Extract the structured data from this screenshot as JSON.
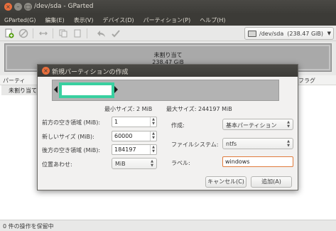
{
  "window": {
    "title": "/dev/sda - GParted",
    "close_glyph": "×",
    "min_glyph": "–",
    "max_glyph": "□"
  },
  "menubar": {
    "items": [
      "GParted(G)",
      "編集(E)",
      "表示(V)",
      "デバイス(D)",
      "パーティション(P)",
      "ヘルプ(H)"
    ]
  },
  "toolbar": {
    "icons": [
      "new-icon",
      "delete-icon",
      "resize-icon",
      "copy-icon",
      "paste-icon",
      "undo-icon",
      "apply-icon"
    ],
    "device_label": "/dev/sda",
    "device_size": "(238.47 GiB)"
  },
  "disk": {
    "label": "未割り当て",
    "size": "238.47 GiB"
  },
  "partition_list": {
    "headers": [
      "パーティ",
      "フラグ"
    ],
    "rows": [
      "未割り当て"
    ]
  },
  "statusbar": {
    "text": "0 件の操作を保留中"
  },
  "dialog": {
    "title": "新規パーティションの作成",
    "close_glyph": "×",
    "min_size": "最小サイズ: 2 MiB",
    "max_size": "最大サイズ: 244197 MiB",
    "fields": {
      "free_before": {
        "label": "前方の空き領域 (MiB):",
        "value": "1"
      },
      "new_size": {
        "label": "新しいサイズ (MiB):",
        "value": "60000"
      },
      "free_after": {
        "label": "後方の空き領域 (MiB):",
        "value": "184197"
      },
      "align": {
        "label": "位置あわせ:",
        "value": "MiB"
      },
      "create_as": {
        "label": "作成:",
        "value": "基本パーティション"
      },
      "filesystem": {
        "label": "ファイルシステム:",
        "value": "ntfs"
      },
      "label": {
        "label": "ラベル:",
        "value": "windows"
      }
    },
    "buttons": {
      "cancel": "キャンセル(C)",
      "add": "追加(A)"
    }
  },
  "colors": {
    "accent_orange": "#e86e3c",
    "partition_border": "#39d0a0",
    "titlebar": "#3c3b37"
  }
}
